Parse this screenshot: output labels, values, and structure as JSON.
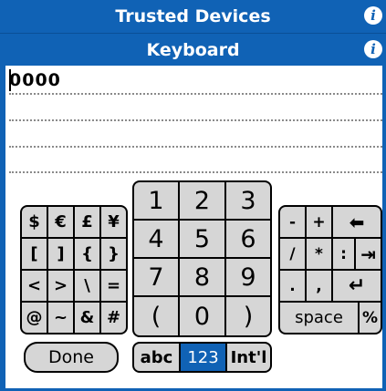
{
  "header": {
    "title": "Trusted Devices",
    "subtitle": "Keyboard",
    "info_icon": "i"
  },
  "input": {
    "value": "0000"
  },
  "symbol_keys": [
    "$",
    "€",
    "£",
    "¥",
    "[",
    "]",
    "{",
    "}",
    "<",
    ">",
    "\\",
    "=",
    "@",
    "~",
    "&",
    "#"
  ],
  "number_keys": [
    "1",
    "2",
    "3",
    "4",
    "5",
    "6",
    "7",
    "8",
    "9",
    "(",
    "0",
    ")"
  ],
  "ops_keys": {
    "minus": "-",
    "plus": "+",
    "backspace": "⬅",
    "slash": "/",
    "star": "*",
    "colon": ":",
    "tab": "⇥",
    "period": ".",
    "comma": ",",
    "enter": "↵",
    "space": "space",
    "percent": "%"
  },
  "done_label": "Done",
  "modes": {
    "abc": "abc",
    "num": "123",
    "intl": "Int'l",
    "active": "123"
  },
  "colors": {
    "accent": "#1062b5",
    "key_face": "#d6d6d6"
  }
}
